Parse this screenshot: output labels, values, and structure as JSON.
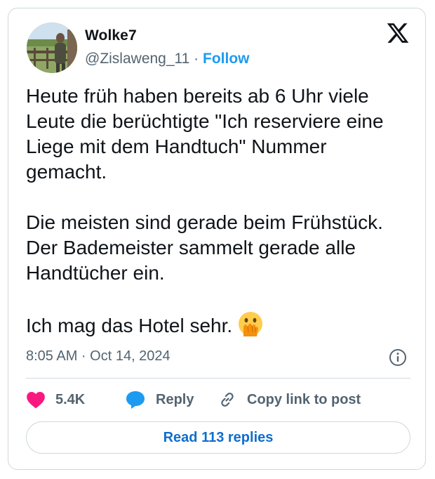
{
  "tweet": {
    "author_name": "Wolke7",
    "handle": "@Zislaweng_11",
    "separator": " · ",
    "follow_label": "Follow",
    "text": "Heute früh haben bereits ab 6 Uhr viele\nLeute die berüchtigte \"Ich reserviere eine\nLiege mit dem Handtuch\" Nummer\ngemacht.\n\nDie meisten sind gerade beim Frühstück.\nDer Bademeister sammelt gerade alle\nHandtücher ein.\n\nIch mag das Hotel sehr. ",
    "emoji_icon": "face-with-hand-over-mouth-icon",
    "timestamp": "8:05 AM · Oct 14, 2024"
  },
  "actions": {
    "like_count": "5.4K",
    "reply_label": "Reply",
    "copy_link_label": "Copy link to post"
  },
  "read_replies_label": "Read 113 replies",
  "colors": {
    "like_pink": "#f91880",
    "reply_blue": "#1d9bf0",
    "link_blue": "#0f6ecd",
    "muted_text": "#536471",
    "border": "#cfd9de"
  }
}
